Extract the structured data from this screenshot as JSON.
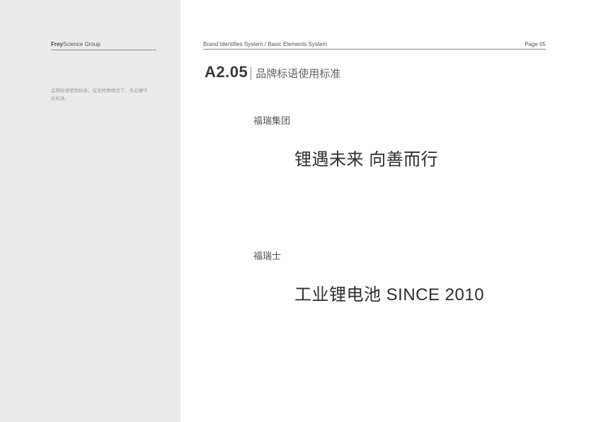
{
  "sidebar": {
    "brand_part1": "Frey",
    "brand_part2": "Science Group",
    "note_line1": "品牌标语使用标准，在无特殊情况下，务必遵守",
    "note_line2": "此标准。"
  },
  "header": {
    "breadcrumb": "Brand Identifies System  /  Basic Elements System",
    "page": "Page 05"
  },
  "section": {
    "code": "A2.05",
    "name": "品牌标语使用标准"
  },
  "slogans": [
    {
      "label": "福瑞集团",
      "text": "锂遇未来 向善而行"
    },
    {
      "label": "福瑞士",
      "text": "工业锂电池 SINCE 2010"
    }
  ],
  "colors": {
    "sidebar_bg": "#ebebec",
    "text_dark": "#2e2e2e",
    "rule": "#8a8a8a"
  }
}
